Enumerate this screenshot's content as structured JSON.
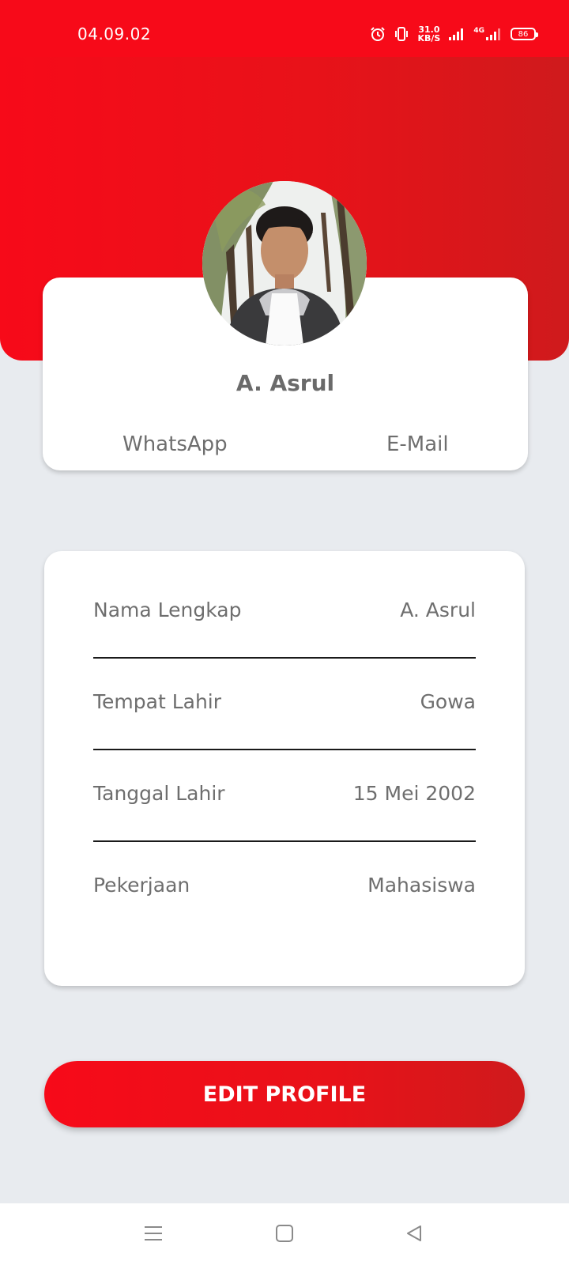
{
  "status_bar": {
    "time": "04.09.02",
    "net_speed_value": "31.0",
    "net_speed_unit": "KB/S",
    "network_type": "4G",
    "battery_level": "86",
    "icons": [
      "alarm-icon",
      "vibrate-icon",
      "signal-icon",
      "signal-4g-icon",
      "battery-icon"
    ]
  },
  "colors": {
    "primary": "#f70a19",
    "primary_dark": "#cf1a1c",
    "background": "#e8ebef",
    "card": "#ffffff",
    "text": "#6e6e6e"
  },
  "profile": {
    "name": "A. Asrul",
    "contacts": {
      "whatsapp": "WhatsApp",
      "email": "E-Mail"
    }
  },
  "info": [
    {
      "label": "Nama Lengkap",
      "value": "A. Asrul"
    },
    {
      "label": "Tempat Lahir",
      "value": "Gowa"
    },
    {
      "label": "Tanggal Lahir",
      "value": "15 Mei 2002"
    },
    {
      "label": "Pekerjaan",
      "value": "Mahasiswa"
    }
  ],
  "actions": {
    "edit_profile": "EDIT PROFILE"
  },
  "nav": {
    "icons": [
      "menu-icon",
      "home-square-icon",
      "back-triangle-icon"
    ]
  }
}
